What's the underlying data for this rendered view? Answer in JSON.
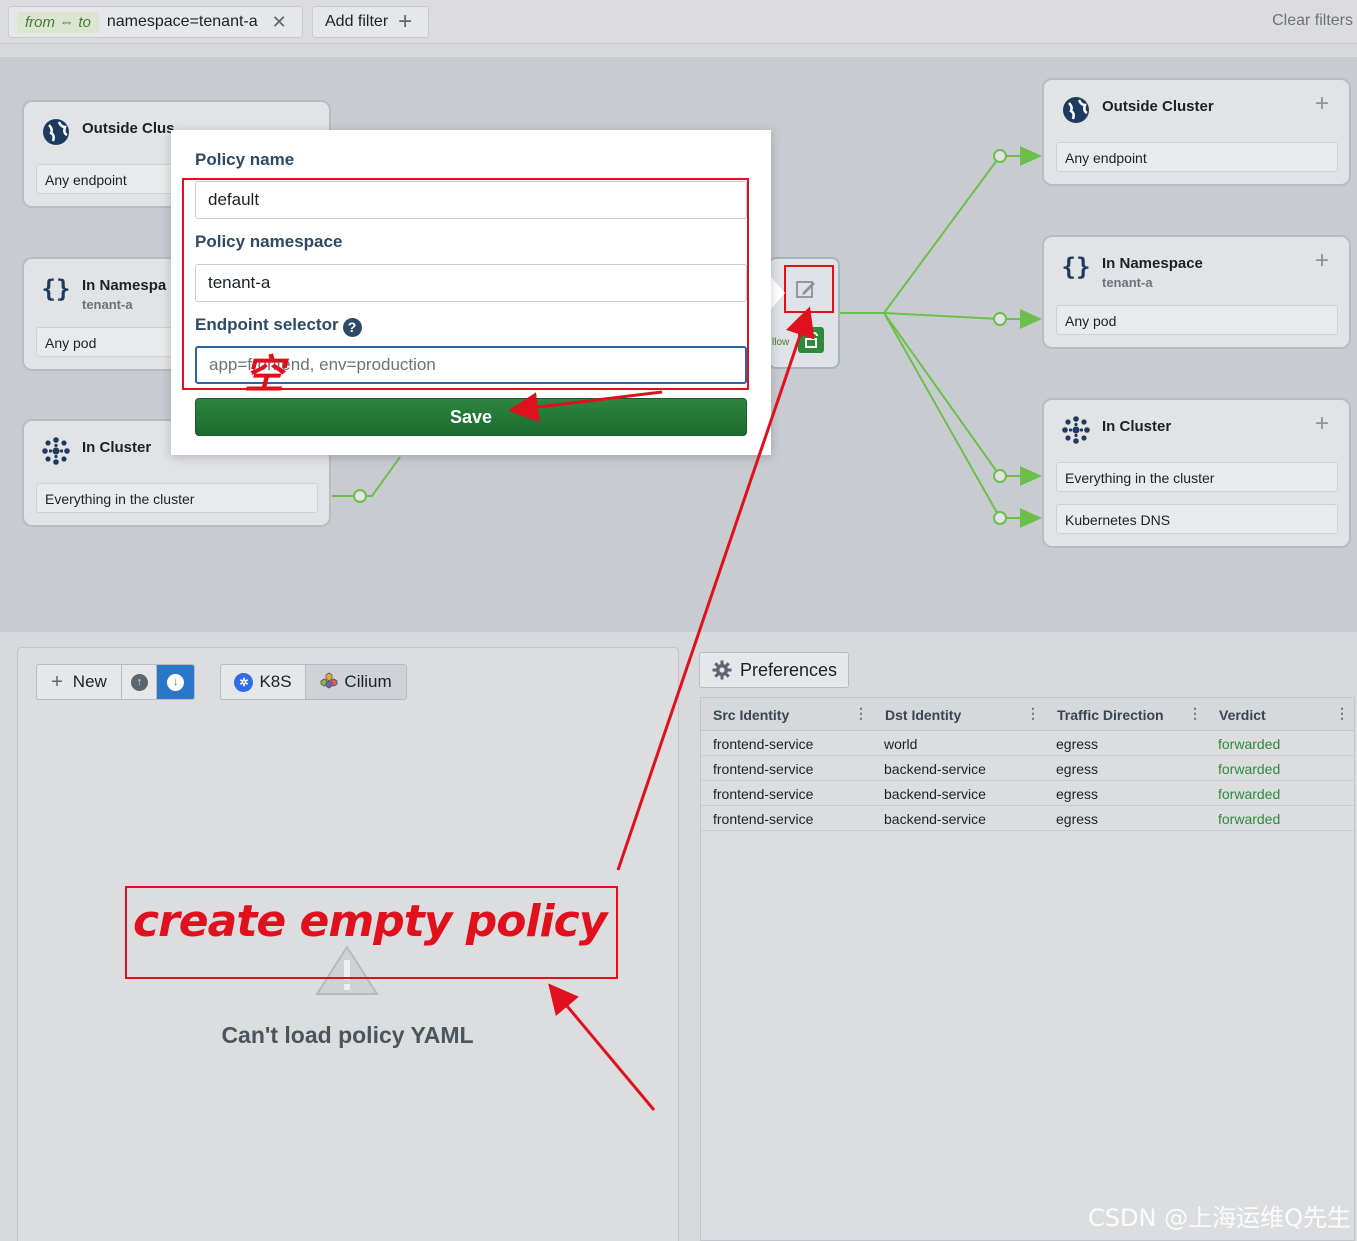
{
  "filter_bar": {
    "direction_tag": "from ⇔ to",
    "filter_value": "namespace=tenant-a",
    "remove_glyph": "✕",
    "add_filter_label": "Add filter",
    "clear_filters_label": "Clear filters"
  },
  "ingress_cards": {
    "outside": {
      "title": "Outside Clus",
      "endpoint": "Any endpoint"
    },
    "namespace": {
      "title": "In Namespa",
      "subtitle": "tenant-a",
      "endpoint": "Any pod"
    },
    "cluster": {
      "title": "In Cluster",
      "endpoint": "Everything in the cluster"
    }
  },
  "egress_cards": {
    "outside": {
      "title": "Outside Cluster",
      "endpoint": "Any endpoint"
    },
    "namespace": {
      "title": "In Namespace",
      "subtitle": "tenant-a",
      "endpoint": "Any pod"
    },
    "cluster": {
      "title": "In Cluster",
      "endpoints": [
        "Everything in the cluster",
        "Kubernetes DNS"
      ]
    }
  },
  "center_node": {
    "allow_label": "llow"
  },
  "policy_popover": {
    "name_label": "Policy name",
    "name_value": "default",
    "namespace_label": "Policy namespace",
    "namespace_value": "tenant-a",
    "selector_label": "Endpoint selector",
    "selector_placeholder": "app=frontend, env=production",
    "save_label": "Save"
  },
  "policy_panel": {
    "new_label": "New",
    "k8s_label": "K8S",
    "cilium_label": "Cilium",
    "error_message": "Can't load policy YAML"
  },
  "flows": {
    "preferences_label": "Preferences",
    "columns": [
      "Src Identity",
      "Dst Identity",
      "Traffic Direction",
      "Verdict"
    ],
    "rows": [
      [
        "frontend-service",
        "world",
        "egress",
        "forwarded"
      ],
      [
        "frontend-service",
        "backend-service",
        "egress",
        "forwarded"
      ],
      [
        "frontend-service",
        "backend-service",
        "egress",
        "forwarded"
      ],
      [
        "frontend-service",
        "backend-service",
        "egress",
        "forwarded"
      ]
    ]
  },
  "annotations": {
    "empty_char": "空",
    "caption": "create empty policy",
    "watermark": "CSDN @上海运维Q先生"
  },
  "colors": {
    "annotation_red": "#e0101c",
    "allow_green": "#2e8b3c",
    "edge_green": "#6cc04a",
    "save_green": "#1c6a2e",
    "download_blue": "#2a77c9"
  }
}
